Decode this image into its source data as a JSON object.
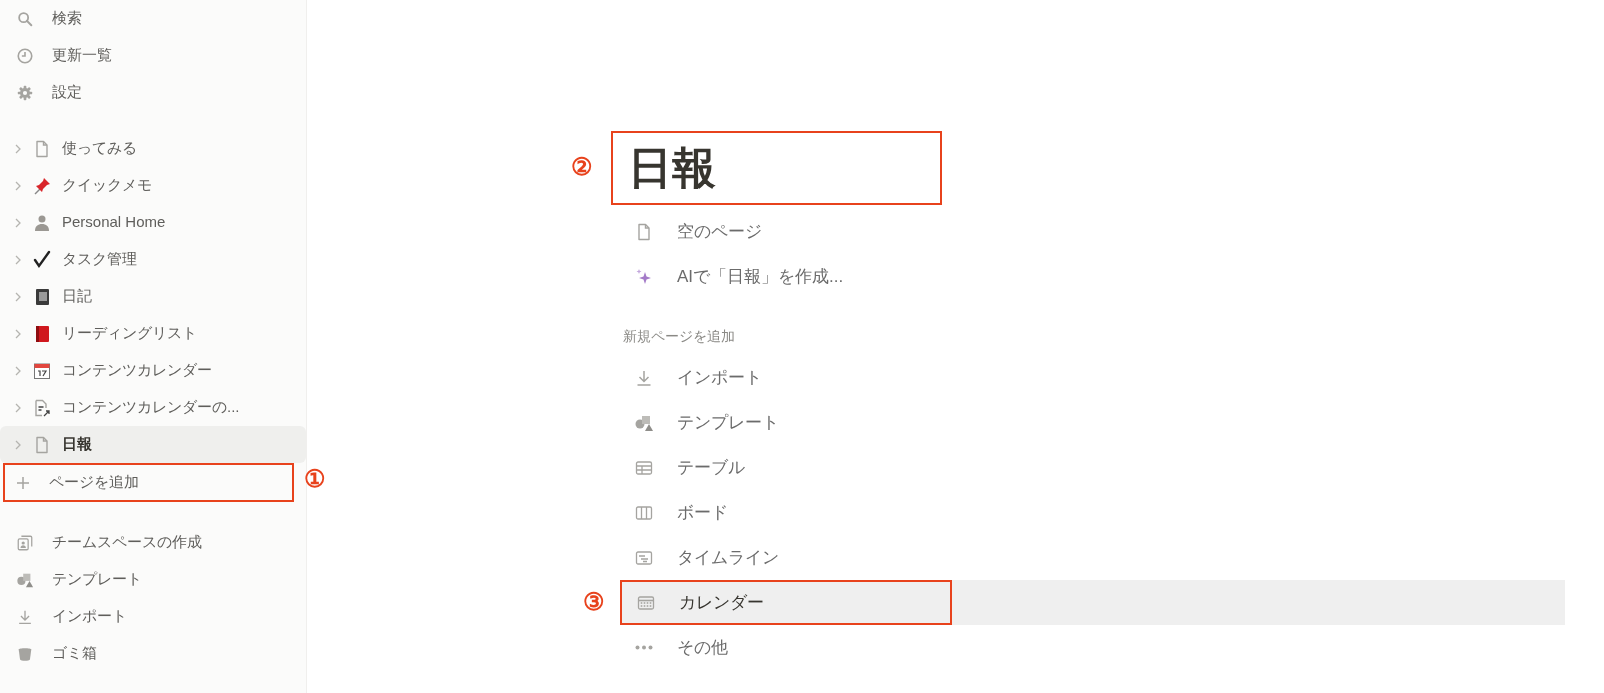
{
  "sidebar": {
    "nav": [
      {
        "kind": "search",
        "label": "検索"
      },
      {
        "kind": "clock",
        "label": "更新一覧"
      },
      {
        "kind": "gear",
        "label": "設定"
      }
    ],
    "pages": [
      {
        "kind": "doc",
        "label": "使ってみる",
        "selected": false
      },
      {
        "kind": "pin",
        "label": "クイックメモ",
        "selected": false
      },
      {
        "kind": "person",
        "label": "Personal Home",
        "selected": false
      },
      {
        "kind": "check",
        "label": "タスク管理",
        "selected": false
      },
      {
        "kind": "notebook",
        "label": "日記",
        "selected": false
      },
      {
        "kind": "book",
        "label": "リーディングリスト",
        "selected": false
      },
      {
        "kind": "calendar",
        "label": "コンテンツカレンダー",
        "selected": false
      },
      {
        "kind": "doc-link",
        "label": "コンテンツカレンダーの...",
        "selected": false
      },
      {
        "kind": "doc",
        "label": "日報",
        "selected": true
      }
    ],
    "add_page": {
      "label": "ページを追加",
      "annotation": "①"
    },
    "footer": [
      {
        "kind": "team",
        "label": "チームスペースの作成"
      },
      {
        "kind": "shapes",
        "label": "テンプレート"
      },
      {
        "kind": "import",
        "label": "インポート"
      },
      {
        "kind": "trash",
        "label": "ゴミ箱"
      }
    ]
  },
  "page": {
    "title": "日報",
    "title_annotation": "②",
    "options": [
      {
        "kind": "doc",
        "label": "空のページ"
      },
      {
        "kind": "sparkle",
        "label": "AIで「日報」を作成..."
      }
    ],
    "section": "新規ページを追加",
    "items": [
      {
        "kind": "import",
        "label": "インポート",
        "selected": false
      },
      {
        "kind": "shapes",
        "label": "テンプレート",
        "selected": false
      },
      {
        "kind": "table",
        "label": "テーブル",
        "selected": false
      },
      {
        "kind": "board",
        "label": "ボード",
        "selected": false
      },
      {
        "kind": "timeline",
        "label": "タイムライン",
        "selected": false
      },
      {
        "kind": "calendar-grid",
        "label": "カレンダー",
        "selected": true,
        "annotation": "③"
      },
      {
        "kind": "dots",
        "label": "その他",
        "selected": false
      }
    ]
  }
}
